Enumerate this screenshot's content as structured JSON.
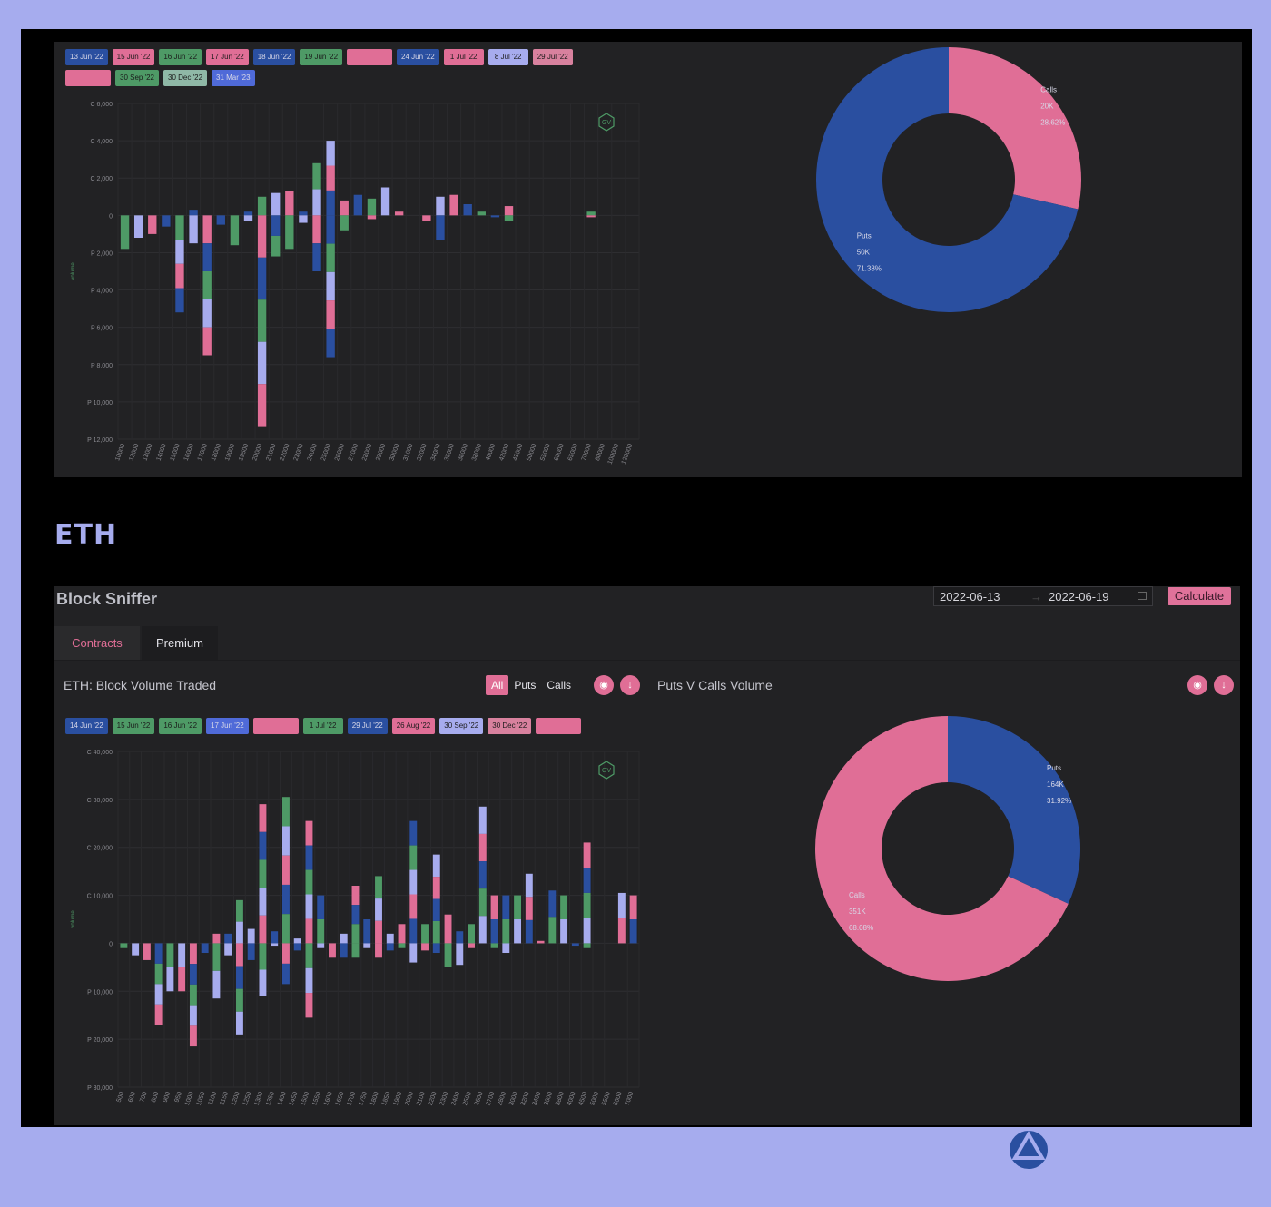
{
  "colors": {
    "pink": "#e06e96",
    "blue": "#2a4fa0",
    "green": "#4e9a66",
    "lavender": "#a7acee",
    "background": "#a6acee",
    "panel": "#222224"
  },
  "top": {
    "legend": [
      {
        "label": "13 Jun '22",
        "color": "#2a4fa0"
      },
      {
        "label": "15 Jun '22",
        "color": "#e06e96"
      },
      {
        "label": "16 Jun '22",
        "color": "#4e9a66"
      },
      {
        "label": "17 Jun '22",
        "color": "#e06e96"
      },
      {
        "label": "18 Jun '22",
        "color": "#2a4fa0"
      },
      {
        "label": "19 Jun '22",
        "color": "#4e9a66"
      },
      {
        "label": "",
        "color": "#e06e96"
      },
      {
        "label": "24 Jun '22",
        "color": "#2a4fa0"
      },
      {
        "label": "1 Jul '22",
        "color": "#e06e96"
      },
      {
        "label": "8 Jul '22",
        "color": "#a7acee"
      },
      {
        "label": "29 Jul '22",
        "color": "#d8819e"
      },
      {
        "label": "",
        "color": "#e06e96"
      },
      {
        "label": "30 Sep '22",
        "color": "#4e9a66"
      },
      {
        "label": "30 Dec '22",
        "color": "#8fb8a6"
      },
      {
        "label": "31 Mar '23",
        "color": "#4f6ad8"
      }
    ],
    "gv_badge": "GV",
    "pie_labels": {
      "calls": {
        "name": "Calls",
        "value": "20K",
        "pct": "28.62%"
      },
      "puts": {
        "name": "Puts",
        "value": "50K",
        "pct": "71.38%"
      }
    }
  },
  "eth_heading": "ETH",
  "block_sniffer": {
    "title": "Block Sniffer",
    "date_start": "2022-06-13",
    "date_sep": "→",
    "date_end": "2022-06-19",
    "calculate_label": "Calculate",
    "tabs": [
      "Contracts",
      "Premium"
    ],
    "volume_title": "ETH: Block Volume Traded",
    "filters": [
      "All",
      "Puts",
      "Calls"
    ],
    "camera_icon_glyph": "◉",
    "download_icon_glyph": "↓",
    "pie_title": "Puts V Calls Volume",
    "legend": [
      {
        "label": "14 Jun '22",
        "color": "#2a4fa0"
      },
      {
        "label": "15 Jun '22",
        "color": "#4e9a66"
      },
      {
        "label": "16 Jun '22",
        "color": "#4e9a66"
      },
      {
        "label": "17 Jun '22",
        "color": "#4f6ad8"
      },
      {
        "label": "",
        "color": "#e06e96"
      },
      {
        "label": "1 Jul '22",
        "color": "#4e9a66"
      },
      {
        "label": "29 Jul '22",
        "color": "#2a4fa0"
      },
      {
        "label": "26 Aug '22",
        "color": "#e06e96"
      },
      {
        "label": "30 Sep '22",
        "color": "#a7acee"
      },
      {
        "label": "30 Dec '22",
        "color": "#d8819e"
      },
      {
        "label": "",
        "color": "#e06e96"
      }
    ],
    "gv_badge": "GV",
    "pie_labels": {
      "puts": {
        "name": "Puts",
        "value": "164K",
        "pct": "31.92%"
      },
      "calls": {
        "name": "Calls",
        "value": "351K",
        "pct": "68.08%"
      }
    }
  },
  "chart_data": [
    {
      "type": "bar",
      "stacked": true,
      "title": "",
      "xlabel": "",
      "ylabel": "volume",
      "ylim": [
        -12000,
        6000
      ],
      "yticks": [
        6000,
        4000,
        2000,
        0,
        -2000,
        -4000,
        -6000,
        -8000,
        -10000,
        -12000
      ],
      "ytick_labels": [
        "C 6,000",
        "C 4,000",
        "C 2,000",
        "0",
        "P 2,000",
        "P 4,000",
        "P 6,000",
        "P 8,000",
        "P 10,000",
        "P 12,000"
      ],
      "categories": [
        "10000",
        "12000",
        "13000",
        "14000",
        "15000",
        "16000",
        "17000",
        "18000",
        "19000",
        "19500",
        "20000",
        "21000",
        "22000",
        "23000",
        "24000",
        "25000",
        "26000",
        "27000",
        "28000",
        "29000",
        "30000",
        "31000",
        "32000",
        "34000",
        "35000",
        "36000",
        "38000",
        "40000",
        "42000",
        "45000",
        "50000",
        "55000",
        "60000",
        "65000",
        "70000",
        "80000",
        "100000",
        "120000"
      ],
      "series": [
        {
          "name": "calls",
          "values": [
            0,
            0,
            0,
            0,
            0,
            300,
            0,
            0,
            0,
            200,
            1000,
            1200,
            1300,
            200,
            2800,
            4000,
            800,
            1100,
            900,
            1500,
            200,
            0,
            0,
            1000,
            1100,
            600,
            200,
            0,
            500,
            0,
            0,
            0,
            0,
            0,
            200,
            0,
            0,
            0
          ]
        },
        {
          "name": "puts",
          "values": [
            -1800,
            -1200,
            -1000,
            -600,
            -5200,
            -1500,
            -7500,
            -500,
            -1600,
            -300,
            -11300,
            -2200,
            -1800,
            -400,
            -3000,
            -7600,
            -800,
            0,
            -200,
            0,
            0,
            0,
            -300,
            -1300,
            0,
            0,
            0,
            -100,
            -300,
            0,
            0,
            0,
            0,
            0,
            -100,
            0,
            0,
            0
          ]
        }
      ]
    },
    {
      "type": "pie",
      "title": "",
      "categories": [
        "Calls",
        "Puts"
      ],
      "values": [
        20000,
        50000
      ],
      "percent": [
        28.62,
        71.38
      ]
    },
    {
      "type": "bar",
      "stacked": true,
      "title": "ETH: Block Volume Traded",
      "xlabel": "",
      "ylabel": "volume",
      "ylim": [
        -30000,
        40000
      ],
      "yticks": [
        40000,
        30000,
        20000,
        10000,
        0,
        -10000,
        -20000,
        -30000
      ],
      "ytick_labels": [
        "C 40,000",
        "C 30,000",
        "C 20,000",
        "C 10,000",
        "0",
        "P 10,000",
        "P 20,000",
        "P 30,000"
      ],
      "categories": [
        "500",
        "600",
        "700",
        "800",
        "900",
        "950",
        "1000",
        "1050",
        "1100",
        "1150",
        "1200",
        "1250",
        "1300",
        "1350",
        "1400",
        "1450",
        "1500",
        "1550",
        "1600",
        "1650",
        "1700",
        "1750",
        "1800",
        "1850",
        "1900",
        "2000",
        "2100",
        "2200",
        "2300",
        "2400",
        "2500",
        "2600",
        "2700",
        "2800",
        "3000",
        "3200",
        "3400",
        "3600",
        "3800",
        "4000",
        "4500",
        "5000",
        "5500",
        "6000",
        "7000"
      ],
      "series": [
        {
          "name": "calls",
          "values": [
            0,
            0,
            0,
            0,
            0,
            0,
            0,
            0,
            2000,
            2000,
            9000,
            3000,
            29000,
            2500,
            30500,
            1000,
            25500,
            10000,
            0,
            2000,
            12000,
            5000,
            14000,
            2000,
            4000,
            25500,
            4000,
            18500,
            6000,
            2500,
            4000,
            28500,
            10000,
            10000,
            10000,
            14500,
            500,
            11000,
            10000,
            0,
            21000,
            0,
            0,
            10500,
            10000
          ]
        },
        {
          "name": "puts",
          "values": [
            -1000,
            -2500,
            -3500,
            -17000,
            -10000,
            -10000,
            -21500,
            -2000,
            -11500,
            -2500,
            -19000,
            -3500,
            -11000,
            -500,
            -8500,
            -1500,
            -15500,
            -1000,
            -3000,
            -3000,
            -3000,
            -1000,
            -3000,
            -1500,
            -1000,
            -4000,
            -1500,
            -2000,
            -5000,
            -4500,
            -1000,
            0,
            -1000,
            -2000,
            0,
            0,
            0,
            0,
            0,
            -500,
            -1000,
            0,
            0,
            0,
            0
          ]
        }
      ]
    },
    {
      "type": "pie",
      "title": "Puts V Calls Volume",
      "categories": [
        "Puts",
        "Calls"
      ],
      "values": [
        164000,
        351000
      ],
      "percent": [
        31.92,
        68.08
      ]
    }
  ]
}
